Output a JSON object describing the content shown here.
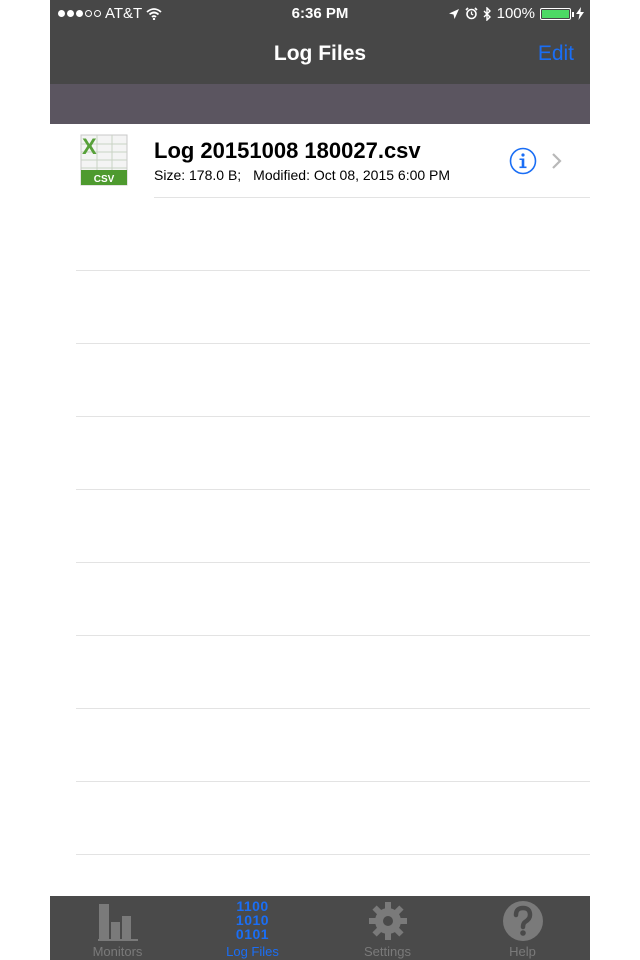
{
  "status_bar": {
    "carrier": "AT&T",
    "time": "6:36 PM",
    "battery": "100%",
    "signal_bars_filled": 3,
    "signal_bars_total": 5,
    "battery_level": 1.0
  },
  "nav": {
    "title": "Log Files",
    "edit_label": "Edit"
  },
  "files": [
    {
      "name": "Log 20151008 180027.csv",
      "size": "Size: 178.0 B;",
      "modified": "Modified: Oct 08, 2015 6:00 PM",
      "icon_label": "CSV"
    }
  ],
  "tabs": [
    {
      "label": "Monitors",
      "icon": "bar-chart-icon",
      "active": false
    },
    {
      "label": "Log Files",
      "icon": "binary-icon",
      "active": true,
      "icon_text": [
        "1100",
        "1010",
        "0101"
      ]
    },
    {
      "label": "Settings",
      "icon": "gear-icon",
      "active": false
    },
    {
      "label": "Help",
      "icon": "question-icon",
      "active": false
    }
  ],
  "colors": {
    "bar_bg": "#474747",
    "band": "#5b5560",
    "accent": "#1a6ef5",
    "battery": "#4cd964"
  }
}
